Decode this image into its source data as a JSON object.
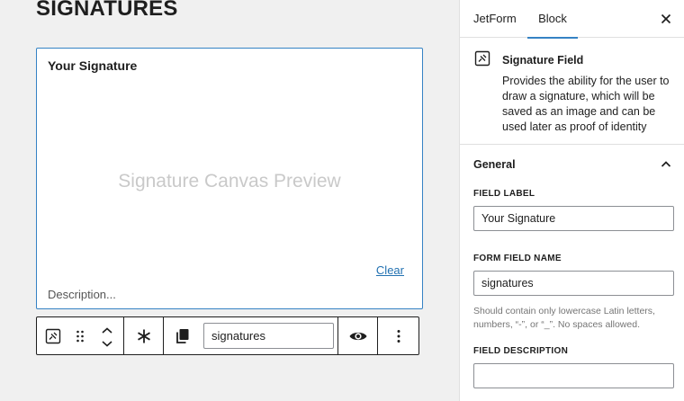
{
  "editor": {
    "page_title": "SIGNATURES",
    "signature_block": {
      "label": "Your Signature",
      "preview_text": "Signature Canvas Preview",
      "clear_label": "Clear",
      "description_placeholder": "Description..."
    },
    "toolbar": {
      "field_name_value": "signatures",
      "icons": [
        "signature-icon",
        "drag-handle-icon",
        "chevron-up-icon",
        "chevron-down-icon",
        "asterisk-icon",
        "copy-icon",
        "eye-icon",
        "more-options-icon"
      ]
    }
  },
  "sidebar": {
    "tabs": [
      {
        "label": "JetForm"
      },
      {
        "label": "Block"
      }
    ],
    "active_tab": "Block",
    "block_card": {
      "name": "Signature Field",
      "description": "Provides the ability for the user to draw a signature, which will be saved as an image and can be used later as proof of identity"
    },
    "panel": {
      "title": "General",
      "fields": {
        "field_label": {
          "label": "FIELD LABEL",
          "value": "Your Signature"
        },
        "form_field_name": {
          "label": "FORM FIELD NAME",
          "value": "signatures",
          "help": "Should contain only lowercase Latin letters, numbers, “-”, or “_”. No spaces allowed."
        },
        "field_description": {
          "label": "FIELD DESCRIPTION",
          "value": ""
        }
      }
    }
  },
  "colors": {
    "accent": "#3582c4",
    "link": "#2271b1",
    "canvas_bg": "#f0f0f0",
    "preview_text": "#c9c9c9"
  }
}
